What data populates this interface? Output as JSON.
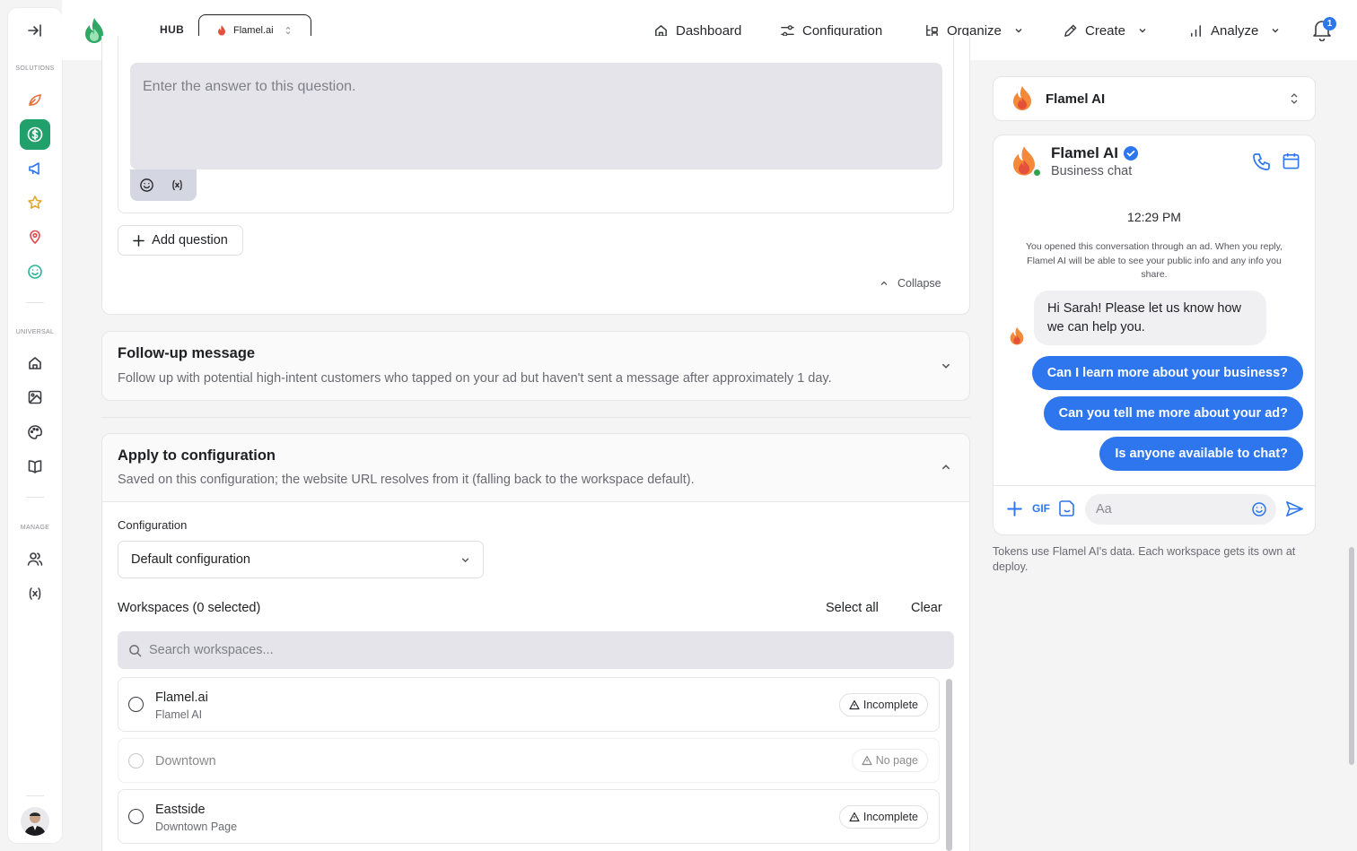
{
  "topbar": {
    "hub_label": "HUB",
    "workspace": "Flamel.ai",
    "nav": [
      {
        "label": "Dashboard",
        "icon": "home-icon"
      },
      {
        "label": "Configuration",
        "icon": "sliders-icon"
      },
      {
        "label": "Organize",
        "icon": "organize-icon"
      },
      {
        "label": "Create",
        "icon": "pen-icon"
      },
      {
        "label": "Analyze",
        "icon": "bar-chart-icon"
      }
    ],
    "notification_count": "1"
  },
  "sidebar": {
    "solutions_label": "SOLUTIONS",
    "universal_label": "UNIVERSAL",
    "manage_label": "MANAGE",
    "accent_color": "#22a06b"
  },
  "question": {
    "answer_placeholder": "Enter the answer to this question.",
    "add_question_label": "Add question",
    "collapse_label": "Collapse"
  },
  "followup": {
    "title": "Follow-up message",
    "description": "Follow up with potential high-intent customers who tapped on your ad but haven't sent a message after approximately 1 day."
  },
  "apply": {
    "title": "Apply to configuration",
    "description": "Saved on this configuration; the website URL resolves from it (falling back to the workspace default).",
    "config_label": "Configuration",
    "config_value": "Default configuration",
    "workspaces_label": "Workspaces (0 selected)",
    "select_all": "Select all",
    "clear": "Clear",
    "search_placeholder": "Search workspaces...",
    "workspaces": [
      {
        "name": "Flamel.ai",
        "sub": "Flamel AI",
        "status": "Incomplete"
      },
      {
        "name": "Downtown",
        "sub": "",
        "status": "No page"
      },
      {
        "name": "Eastside",
        "sub": "Downtown Page",
        "status": "Incomplete"
      }
    ]
  },
  "preview": {
    "selector_name": "Flamel AI",
    "chat_name": "Flamel AI",
    "chat_sub": "Business chat",
    "time": "12:29 PM",
    "notice": "You opened this conversation through an ad. When you reply, Flamel AI will be able to see your public info and any info you share.",
    "greeting": "Hi Sarah! Please let us know how we can help you.",
    "quick_replies": [
      "Can I learn more about your business?",
      "Can you tell me more about your ad?",
      "Is anyone available to chat?"
    ],
    "gif_label": "GIF",
    "input_placeholder": "Aa",
    "footnote": "Tokens use Flamel AI's data. Each workspace gets its own at deploy.",
    "accent_color": "#2d76ee"
  }
}
